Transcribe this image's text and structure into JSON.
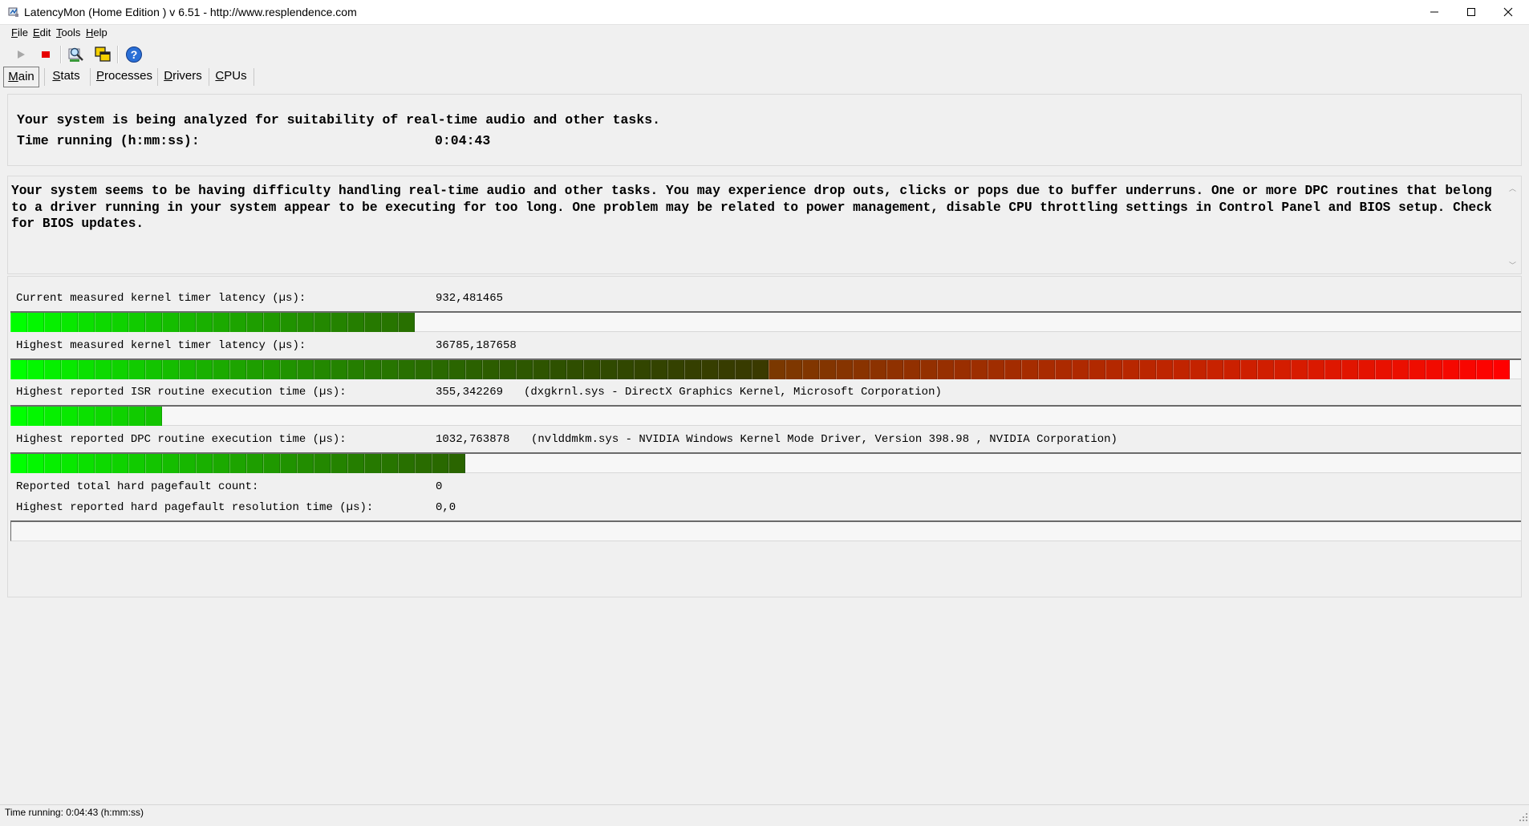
{
  "window": {
    "title": "LatencyMon  (Home Edition )  v 6.51 - http://www.resplendence.com",
    "controls": [
      "minimize",
      "maximize",
      "close"
    ]
  },
  "menu": {
    "items": [
      {
        "label": "File"
      },
      {
        "label": "Edit"
      },
      {
        "label": "Tools"
      },
      {
        "label": "Help"
      }
    ]
  },
  "toolbar": {
    "buttons": [
      {
        "icon": "play-icon"
      },
      {
        "icon": "stop-icon"
      },
      {
        "icon": "magnifier-icon"
      },
      {
        "icon": "windows-icon"
      },
      {
        "icon": "help-icon"
      }
    ]
  },
  "tabs": [
    {
      "label": "Main",
      "active": true
    },
    {
      "label": "Stats"
    },
    {
      "label": "Processes"
    },
    {
      "label": "Drivers"
    },
    {
      "label": "CPUs"
    }
  ],
  "summary": {
    "headline": "Your system is being analyzed for suitability of real-time audio and other tasks.",
    "time_label": "Time running (h:mm:ss):",
    "time_value": "0:04:43"
  },
  "message": {
    "text": "Your system seems to be having difficulty handling real-time audio and other tasks. You may experience drop outs, clicks or pops due to buffer underruns. One or more DPC routines that belong to a driver running in your system appear to be executing for too long. One problem may be related to power management, disable CPU throttling settings in Control Panel and BIOS setup. Check for BIOS updates."
  },
  "metrics": {
    "current_latency": {
      "label": "Current measured kernel timer latency (µs):",
      "value": "932,481465",
      "level": 0.2672
    },
    "highest_latency": {
      "label": "Highest measured kernel timer latency (µs):",
      "value": "36785,187658",
      "level": 1.0
    },
    "isr": {
      "label": "Highest reported ISR routine execution time (µs):",
      "value": "355,342269",
      "detail": "(dxgkrnl.sys - DirectX Graphics Kernel, Microsoft Corporation)",
      "level": 0.105
    },
    "dpc": {
      "label": "Highest reported DPC routine execution time (µs):",
      "value": "1032,763878",
      "detail": "(nvlddmkm.sys - NVIDIA Windows Kernel Mode Driver, Version 398.98 , NVIDIA Corporation)",
      "level": 0.304
    },
    "pagefault_count": {
      "label": "Reported total hard pagefault count:",
      "value": "0"
    },
    "pagefault_time": {
      "label": "Highest reported hard pagefault resolution time (µs):",
      "value": "0,0",
      "level": 0
    }
  },
  "statusbar": {
    "text": "Time running: 0:04:43  (h:mm:ss)"
  },
  "colors": {
    "bar_start": "#00ff00",
    "bar_end": "#ff0000",
    "accent": "#0078d7"
  }
}
